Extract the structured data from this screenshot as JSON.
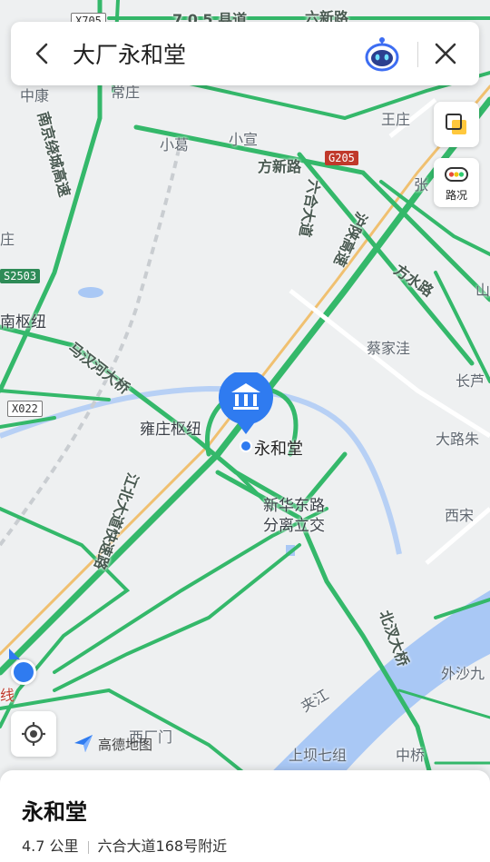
{
  "search": {
    "query": "大厂永和堂"
  },
  "side": {
    "traffic_label": "路况"
  },
  "brand": {
    "name": "高德地图"
  },
  "poi": {
    "name": "永和堂"
  },
  "labels": {
    "road_top_left": "X705",
    "road_top_mid": "7 0 5 县道",
    "road_top_right": "六新路",
    "zhongkang": "中康",
    "changzhuang": "常庄",
    "wangzhuang": "王庄",
    "nanjing_ring": "南京绕城高速",
    "xiaoge": "小葛",
    "xiaoxuan": "小宣",
    "fangxin_rd": "方新路",
    "g205": "G205",
    "zhang": "张",
    "zhuang": "庄",
    "liuhe_ave": "六合大道",
    "hushan_exp": "沪陕高速",
    "fangshui_rd": "方水路",
    "shan": "山",
    "s2503": "S2503",
    "nanshu": "南枢纽",
    "mahanhe_bridge": "马汉河大桥",
    "caijiawa": "蔡家洼",
    "changlu": "长芦",
    "x022": "X022",
    "yongzhuang_hub": "雍庄枢纽",
    "dalu_zhu": "大路朱",
    "jiangbei_exp": "江北大道快速路",
    "xinhua_east_rd": "新华东路",
    "split_interchange": "分离立交",
    "xisong": "西宋",
    "beicha_bridge": "北汊大桥",
    "waishajiu": "外沙九",
    "jiajiang": "夹江",
    "xian": "线",
    "xichangmen": "西厂门",
    "shangba_qizu": "上坝七组",
    "zhongqiao": "中桥"
  },
  "card": {
    "title": "永和堂",
    "distance": "4.7 公里",
    "address": "六合大道168号附近"
  },
  "colors": {
    "road_green": "#34b86a",
    "water": "#a9c8f5",
    "accent_blue": "#2f7bf0",
    "shield_red": "#c0392b"
  }
}
